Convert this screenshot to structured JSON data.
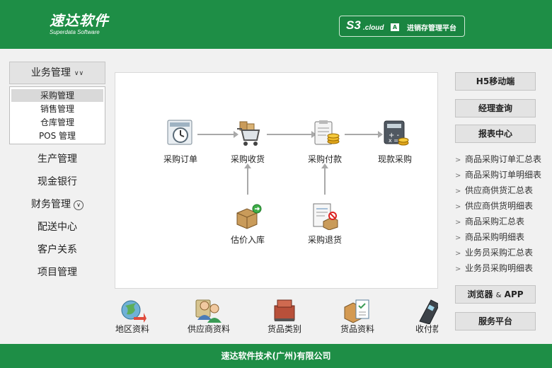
{
  "header": {
    "logo_name": "速达软件",
    "logo_sub": "Superdata Software",
    "product_mark": "S3",
    "product_cloud": ".cloud",
    "product_badge": "A",
    "product_tag": "进销存管理平台"
  },
  "sidebar": {
    "group_label": "业务管理",
    "submenu": [
      "采购管理",
      "销售管理",
      "仓库管理",
      "POS 管理"
    ],
    "items": [
      "生产管理",
      "现金银行",
      "财务管理",
      "配送中心",
      "客户关系",
      "项目管理"
    ]
  },
  "flow": {
    "purchase_order": "采购订单",
    "purchase_receive": "采购收货",
    "purchase_payment": "采购付款",
    "cash_purchase": "现款采购",
    "estimate_stockin": "估价入库",
    "purchase_return": "采购退货"
  },
  "strip": [
    "地区资料",
    "供应商资料",
    "货品类别",
    "货品资料",
    "收付款"
  ],
  "right": {
    "h5_label": "H5移动端",
    "manager_label": "经理查询",
    "reports_label": "报表中心",
    "reports": [
      "商品采购订单汇总表",
      "商品采购订单明细表",
      "供应商供货汇总表",
      "供应商供货明细表",
      "商品采购汇总表",
      "商品采购明细表",
      "业务员采购汇总表",
      "业务员采购明细表"
    ],
    "browser_label": "浏览器",
    "browser_amp": "&",
    "browser_app": "APP",
    "service_label": "服务平台"
  },
  "footer": {
    "company": "速达软件技术(广州)有限公司"
  },
  "colors": {
    "brand_green": "#1e8e46"
  }
}
